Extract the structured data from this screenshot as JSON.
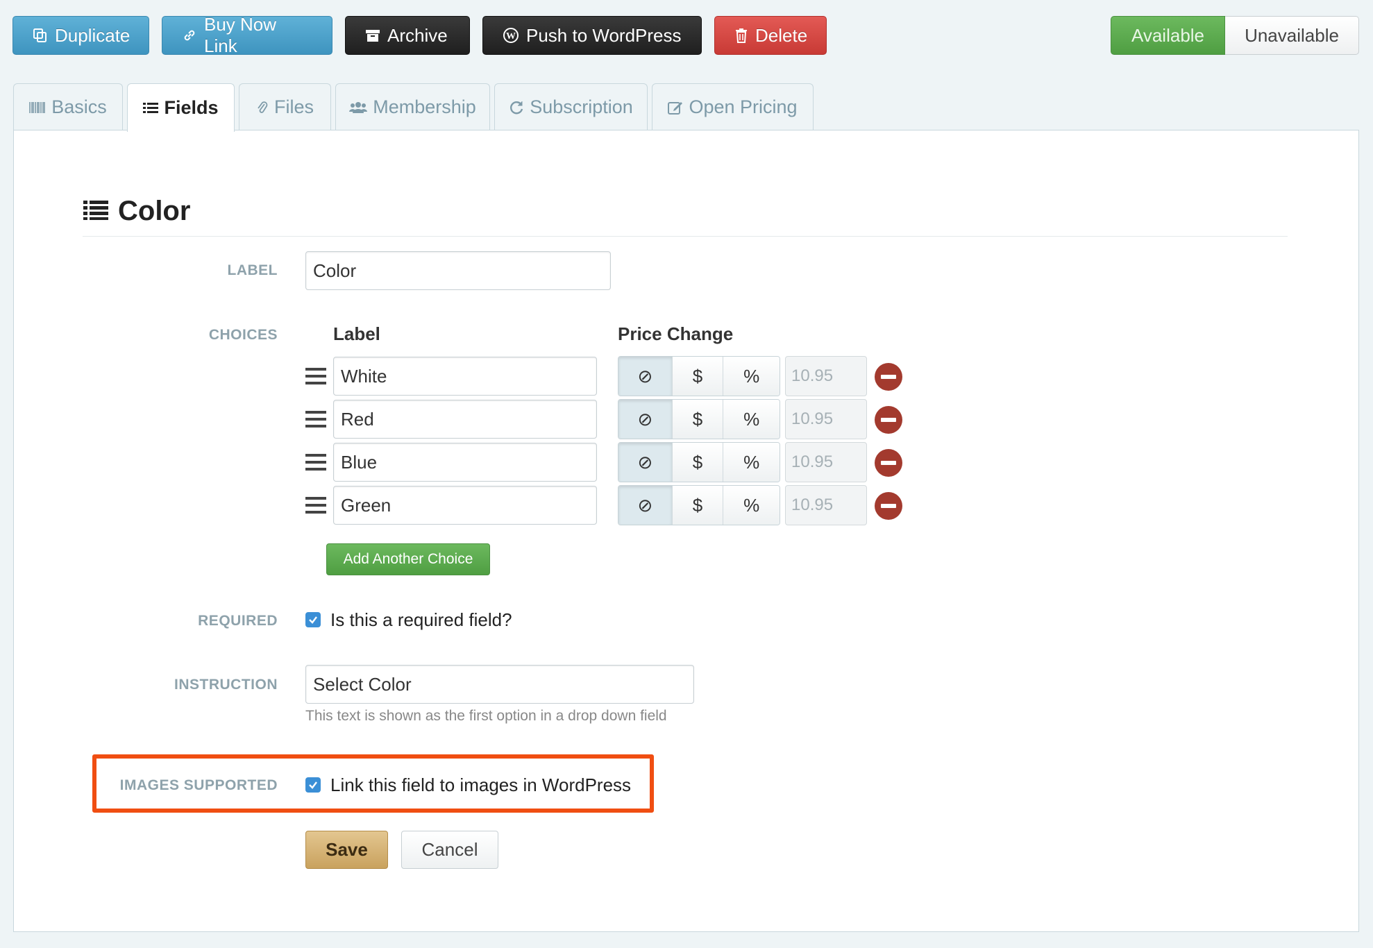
{
  "toolbar": {
    "duplicate": "Duplicate",
    "buy_now_link": "Buy Now Link",
    "archive": "Archive",
    "push_to_wordpress": "Push to WordPress",
    "delete": "Delete"
  },
  "availability": {
    "available": "Available",
    "unavailable": "Unavailable",
    "selected": "Available"
  },
  "tabs": [
    {
      "label": "Basics",
      "icon": "barcode-icon"
    },
    {
      "label": "Fields",
      "icon": "list-icon",
      "active": true
    },
    {
      "label": "Files",
      "icon": "paperclip-icon"
    },
    {
      "label": "Membership",
      "icon": "users-icon"
    },
    {
      "label": "Subscription",
      "icon": "refresh-icon"
    },
    {
      "label": "Open Pricing",
      "icon": "edit-icon"
    }
  ],
  "field": {
    "title": "Color",
    "label_caption": "LABEL",
    "label_value": "Color",
    "choices_caption": "CHOICES",
    "col_label": "Label",
    "col_price_change": "Price Change",
    "choices": [
      {
        "label": "White",
        "price": "10.95"
      },
      {
        "label": "Red",
        "price": "10.95"
      },
      {
        "label": "Blue",
        "price": "10.95"
      },
      {
        "label": "Green",
        "price": "10.95"
      }
    ],
    "price_modes": {
      "none": "⊘",
      "dollar": "$",
      "percent": "%"
    },
    "add_choice": "Add Another Choice",
    "required_caption": "REQUIRED",
    "required_text": "Is this a required field?",
    "required_checked": true,
    "instruction_caption": "INSTRUCTION",
    "instruction_value": "Select Color",
    "instruction_help": "This text is shown as the first option in a drop down field",
    "images_caption": "IMAGES SUPPORTED",
    "images_text": "Link this field to images in WordPress",
    "images_checked": true,
    "save": "Save",
    "cancel": "Cancel"
  },
  "colors": {
    "highlight": "#f04e12",
    "available_green": "#5aab4c",
    "delete_red": "#d9534f",
    "info_blue": "#4ba3cd",
    "remove_red": "#a33a2e",
    "checkbox_blue": "#3b8fd6"
  }
}
